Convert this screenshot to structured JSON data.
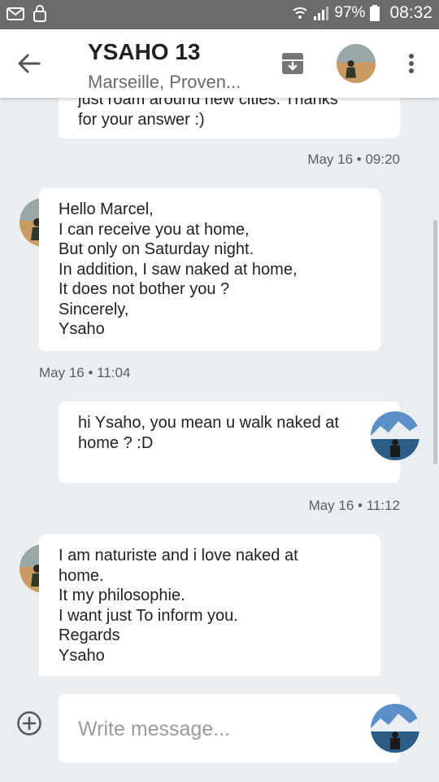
{
  "status_bar": {
    "battery_percent": "97%",
    "time": "08:32",
    "icons": [
      "mail-icon",
      "lock-icon",
      "wifi-icon",
      "signal-icon",
      "battery-icon"
    ]
  },
  "header": {
    "title": "YSAHO 13",
    "subtitle": "Marseille, Proven...",
    "icons": [
      "back-arrow-icon",
      "archive-icon",
      "more-vert-icon"
    ]
  },
  "messages": [
    {
      "direction": "outgoing",
      "text": "just roam around new cities. Thanks\nfor your answer :)",
      "timestamp": "May 16 • 09:20"
    },
    {
      "direction": "incoming",
      "text": "Hello Marcel,\nI can receive you at home,\nBut only on Saturday night.\nIn addition, I saw naked at home,\nIt does not bother you ?\nSincerely,\nYsaho",
      "timestamp": "May 16 • 11:04"
    },
    {
      "direction": "outgoing",
      "text": "hi Ysaho, you mean u walk naked at\nhome  ?  :D",
      "timestamp": "May 16 • 11:12"
    },
    {
      "direction": "incoming",
      "text": "I am naturiste and i love naked at\nhome.\nIt my philosophie.\nI want just To inform you.\nRegards\nYsaho",
      "timestamp": ""
    }
  ],
  "compose": {
    "placeholder": "Write message...",
    "value": ""
  },
  "colors": {
    "background": "#ebeef1",
    "bubble": "#ffffff",
    "status_bar": "#6b6b6b",
    "header": "#ffffff"
  }
}
